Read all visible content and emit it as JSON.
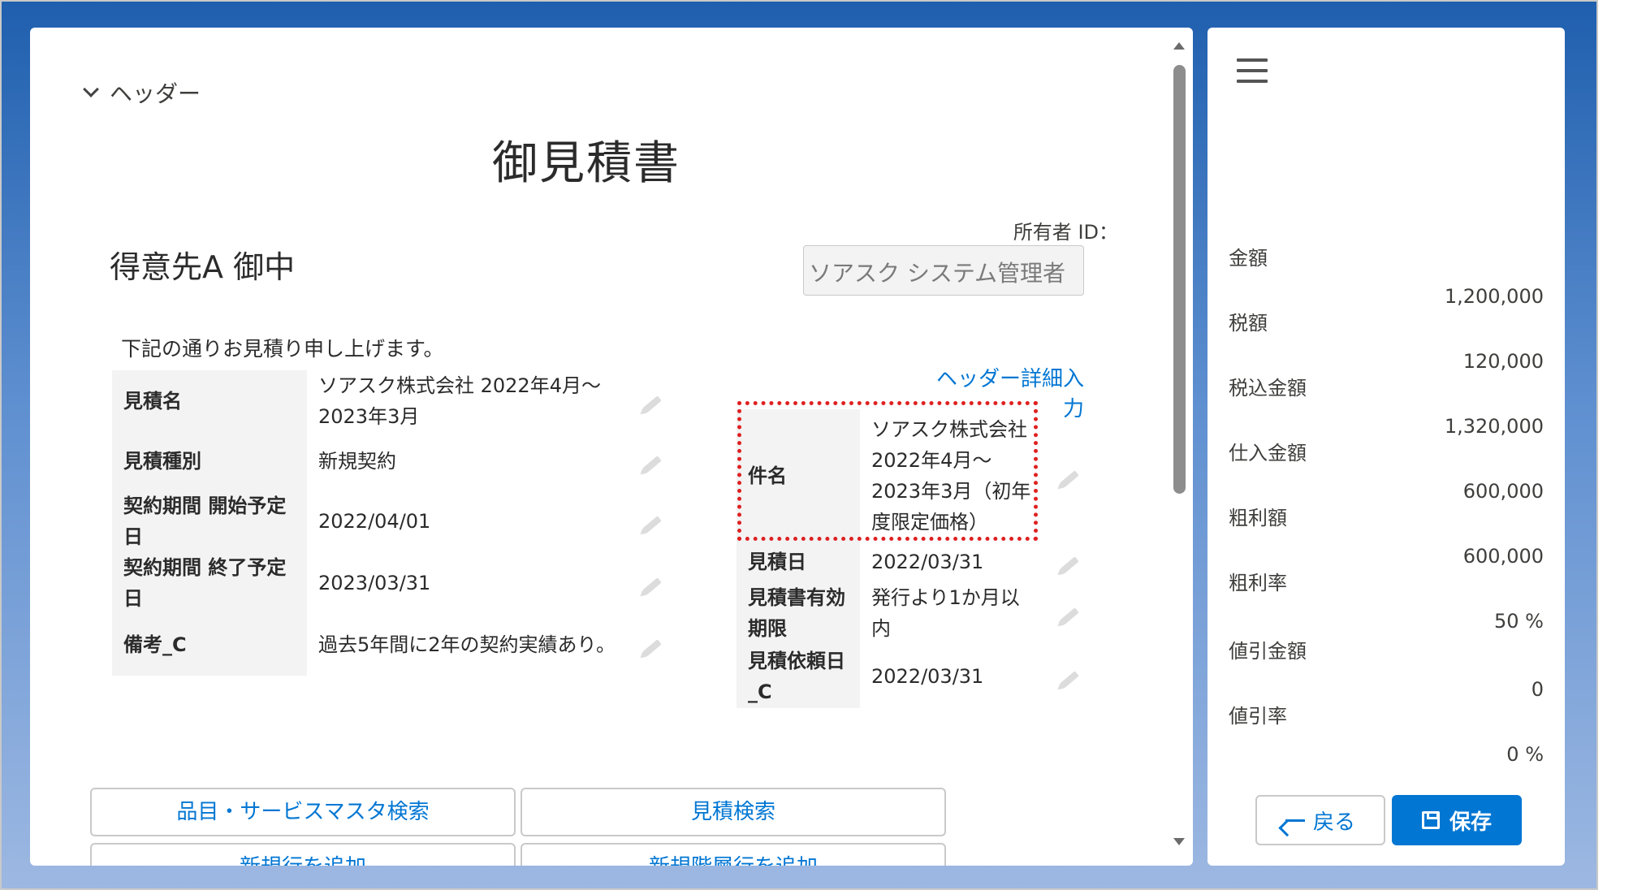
{
  "header": {
    "section_label": "ヘッダー",
    "doc_title": "御見積書",
    "customer": "得意先A 御中",
    "owner_label": "所有者 ID：",
    "owner_value": "ソアスク システム管理者",
    "intro": "下記の通りお見積り申し上げます。",
    "detail_link": "ヘッダー詳細入力"
  },
  "left_table": [
    {
      "label": "見積名",
      "value": "ソアスク株式会社 2022年4月～2023年3月"
    },
    {
      "label": "見積種別",
      "value": "新規契約"
    },
    {
      "label": "契約期間 開始予定日",
      "value": "2022/04/01"
    },
    {
      "label": "契約期間 終了予定日",
      "value": "2023/03/31"
    },
    {
      "label": "備考_C",
      "value": "過去5年間に2年の契約実績あり。"
    }
  ],
  "right_table": [
    {
      "label": "件名",
      "value": "ソアスク株式会社 2022年4月～2023年3月（初年度限定価格）"
    },
    {
      "label": "見積日",
      "value": "2022/03/31"
    },
    {
      "label": "見積書有効期限",
      "value": "発行より1か月以内"
    },
    {
      "label": "見積依頼日_C",
      "value": "2022/03/31"
    }
  ],
  "buttons": {
    "product_search": "品目・サービスマスタ検索",
    "quote_search": "見積検索",
    "new_row": "新規行を追加",
    "new_tier": "新規階層行を追加"
  },
  "summary": [
    {
      "label": "金額",
      "value": "1,200,000"
    },
    {
      "label": "税額",
      "value": "120,000"
    },
    {
      "label": "税込金額",
      "value": "1,320,000"
    },
    {
      "label": "仕入金額",
      "value": "600,000"
    },
    {
      "label": "粗利額",
      "value": "600,000"
    },
    {
      "label": "粗利率",
      "value": "50 %"
    },
    {
      "label": "値引金額",
      "value": "0"
    },
    {
      "label": "値引率",
      "value": "0 %"
    }
  ],
  "actions": {
    "back": "戻る",
    "save": "保存"
  },
  "colors": {
    "accent": "#0176d3",
    "highlight": "#e02020"
  }
}
